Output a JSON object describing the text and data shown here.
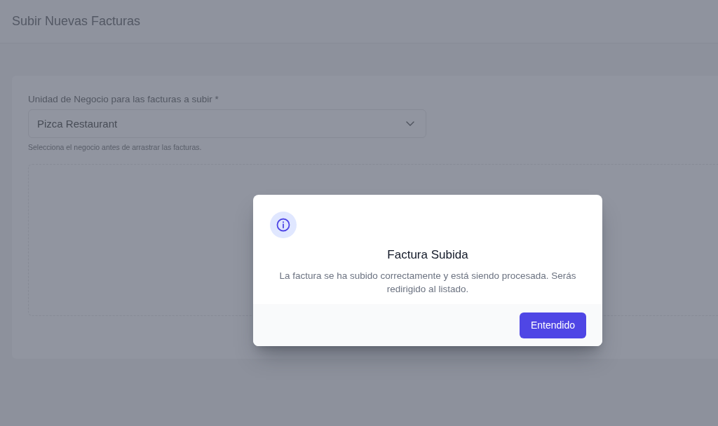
{
  "header": {
    "title": "Subir Nuevas Facturas"
  },
  "form": {
    "business_unit": {
      "label": "Unidad de Negocio para las facturas a subir *",
      "value": "Pizca Restaurant",
      "hint": "Selecciona el negocio antes de arrastrar las facturas."
    }
  },
  "dialog": {
    "title": "Factura Subida",
    "message": "La factura se ha subido correctamente y está siendo procesada. Serás redirigido al listado.",
    "buttons": [
      {
        "label": "Entendido"
      }
    ]
  }
}
